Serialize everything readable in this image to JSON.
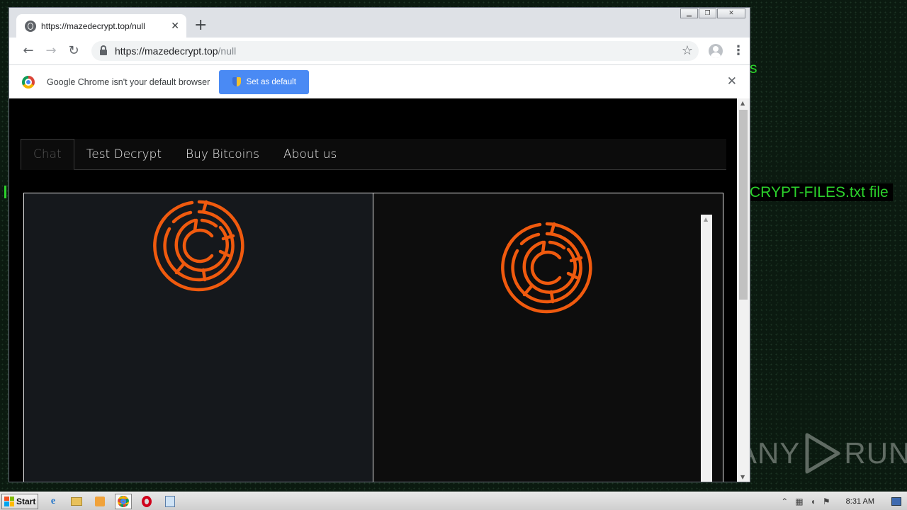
{
  "desktop": {
    "partial_text_1": "s",
    "partial_text_2": "CRYPT-FILES.txt file",
    "watermark": "ANY",
    "watermark_2": "RUN"
  },
  "browser": {
    "window_controls": {
      "minimize": "▁",
      "maximize": "❐",
      "close": "✕"
    },
    "tab": {
      "title": "https://mazedecrypt.top/null",
      "close": "✕"
    },
    "new_tab": "+",
    "nav": {
      "back": "←",
      "forward": "→",
      "reload": "↻"
    },
    "address": {
      "host": "https://mazedecrypt.top",
      "path": "/null"
    },
    "bookmark_icon": "☆",
    "menu_icon": "⋮",
    "infobar": {
      "message": "Google Chrome isn't your default browser",
      "button": "Set as default",
      "close": "✕"
    }
  },
  "page": {
    "nav_items": [
      "Chat",
      "Test Decrypt",
      "Buy Bitcoins",
      "About us"
    ],
    "active_nav": "Chat",
    "logo_color": "#f05a0e"
  },
  "taskbar": {
    "start_label": "Start",
    "clock": "8:31 AM",
    "apps": [
      "internet-explorer",
      "explorer",
      "media-player",
      "chrome",
      "opera",
      "notepad"
    ]
  },
  "colors": {
    "accent": "#4a8af4",
    "maze_orange": "#f05a0e",
    "desktop_text": "#2bd12b"
  }
}
